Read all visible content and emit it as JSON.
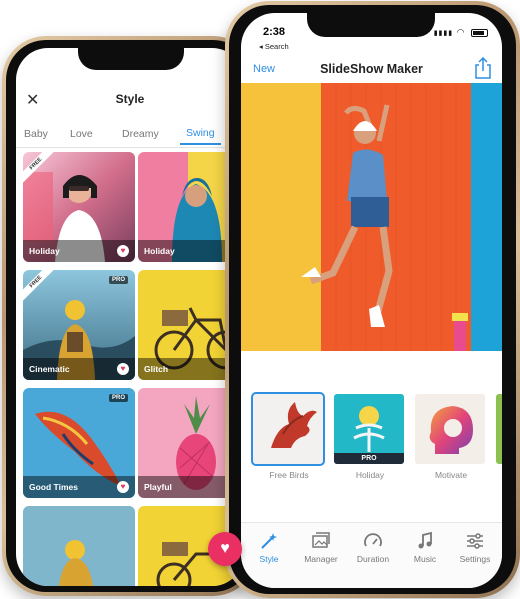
{
  "style_screen": {
    "title": "Style",
    "close_glyph": "✕",
    "tabs": [
      {
        "label": "Baby"
      },
      {
        "label": "Love"
      },
      {
        "label": "Dreamy"
      },
      {
        "label": "Swing",
        "active": true
      }
    ],
    "cards": [
      {
        "label": "Holiday",
        "badge": "FREE",
        "favorite": true
      },
      {
        "label": "Holiday",
        "favorite": true
      },
      {
        "label": "Cinematic",
        "badge": "FREE",
        "pro": "PRO",
        "favorite": true
      },
      {
        "label": "Glitch"
      },
      {
        "label": "Good Times",
        "pro": "PRO",
        "favorite": true
      },
      {
        "label": "Playful"
      },
      {
        "label": ""
      },
      {
        "label": ""
      }
    ],
    "fab_icon": "heart-icon"
  },
  "main_screen": {
    "status": {
      "time": "2:38",
      "back_label": "◂ Search",
      "signal": "▮▮▮▮",
      "wifi": "◠"
    },
    "nav": {
      "new_label": "New",
      "title": "SlideShow Maker",
      "share_icon": "share-icon"
    },
    "filters": [
      {
        "name": "Free Birds",
        "selected": true
      },
      {
        "name": "Holiday",
        "pro": "PRO"
      },
      {
        "name": "Motivate"
      }
    ],
    "tabs": [
      {
        "label": "Style",
        "icon": "magic-wand-icon",
        "active": true
      },
      {
        "label": "Manager",
        "icon": "image-stack-icon"
      },
      {
        "label": "Duration",
        "icon": "speedometer-icon"
      },
      {
        "label": "Music",
        "icon": "music-note-icon"
      },
      {
        "label": "Settings",
        "icon": "sliders-icon"
      }
    ]
  },
  "colors": {
    "accent": "#2f8fe0",
    "heart": "#ea2f63",
    "frame_gold": "#c8aa82"
  }
}
